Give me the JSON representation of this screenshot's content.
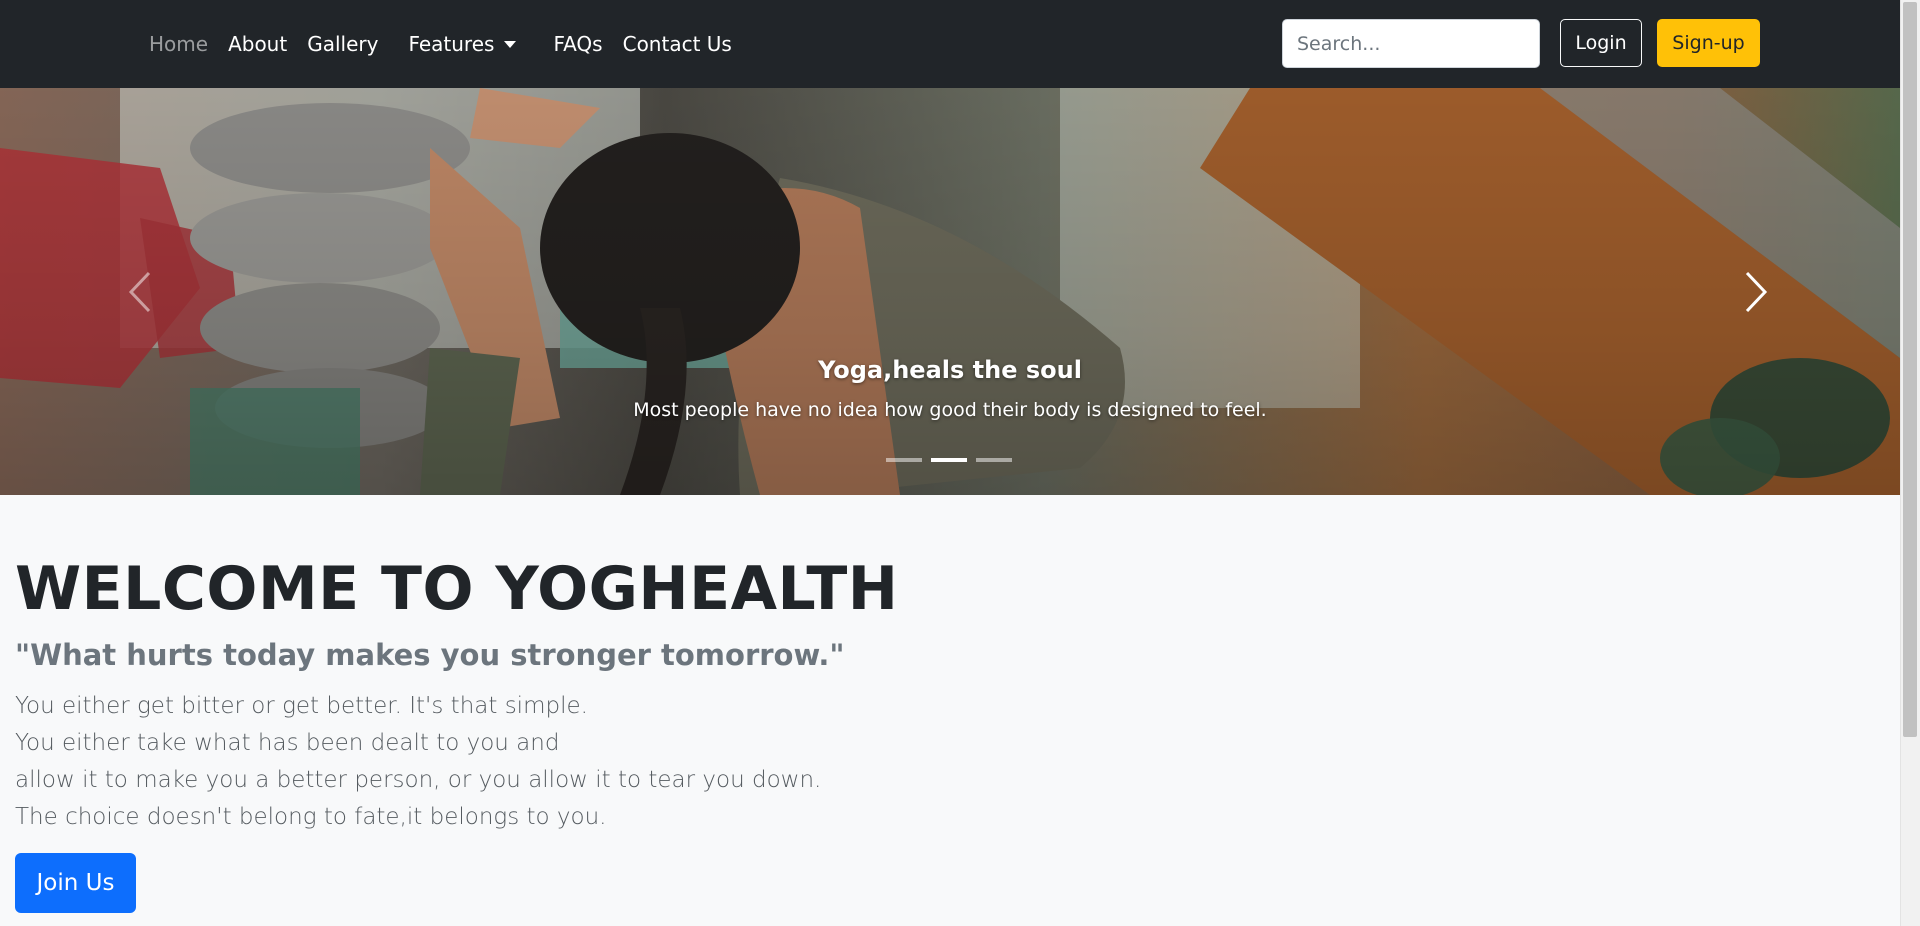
{
  "navbar": {
    "links": [
      {
        "label": "Home",
        "active": true
      },
      {
        "label": "About"
      },
      {
        "label": "Gallery"
      },
      {
        "label": "Features",
        "dropdown": true
      },
      {
        "label": "FAQs"
      },
      {
        "label": "Contact Us"
      }
    ],
    "search_placeholder": "Search...",
    "login_label": "Login",
    "signup_label": "Sign-up"
  },
  "carousel": {
    "caption_title": "Yoga,heals the soul",
    "caption_text": "Most people have no idea how good their body is designed to feel.",
    "slide_count": 3,
    "active_slide": 2,
    "prev_icon": "chevron-left-icon",
    "next_icon": "chevron-right-icon"
  },
  "hero": {
    "heading": "WELCOME TO YOGHEALTH",
    "quote": "\"What hurts today makes you stronger tomorrow.\"",
    "lines": [
      "You either get bitter or get better. It's that simple.",
      "You either take what has been dealt to you and",
      "allow it to make you a better person, or you allow it to tear you down.",
      "The choice doesn't belong to fate,it belongs to you."
    ],
    "join_label": "Join Us"
  },
  "colors": {
    "navbar_bg": "#212529",
    "signup_bg": "#ffc107",
    "join_bg": "#0d6efd",
    "page_bg": "#f8f9fa"
  }
}
